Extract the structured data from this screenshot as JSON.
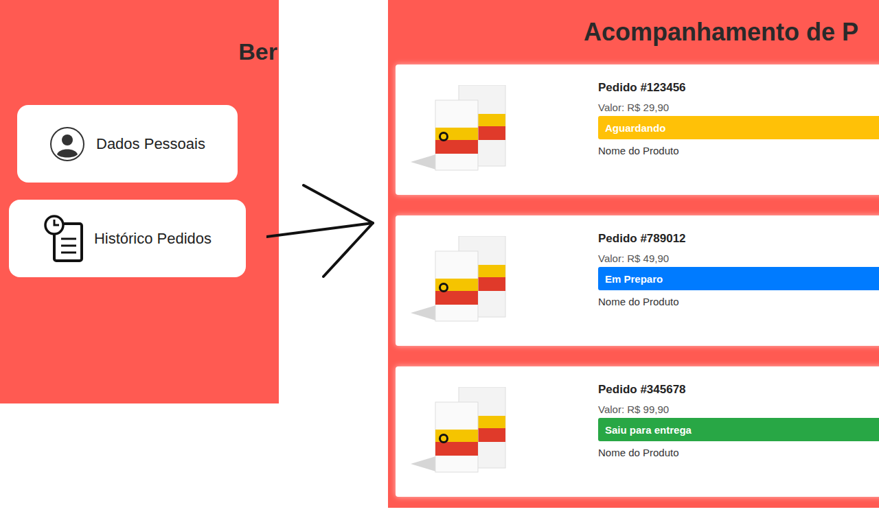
{
  "sidebar": {
    "title": "Ber",
    "items": [
      {
        "label": "Dados Pessoais",
        "kind": "profile",
        "selected": false
      },
      {
        "label": "Histórico Pedidos",
        "kind": "history",
        "selected": true
      }
    ]
  },
  "orders": {
    "title": "Acompanhamento de P",
    "items": [
      {
        "number": "Pedido #123456",
        "value": "Valor: R$ 29,90",
        "status": "Aguardando",
        "color": "#ffc107",
        "product": "Nome do Produto"
      },
      {
        "number": "Pedido #789012",
        "value": "Valor: R$ 49,90",
        "status": "Em Preparo",
        "color": "#007bff",
        "product": "Nome do Produto"
      },
      {
        "number": "Pedido #345678",
        "value": "Valor: R$ 99,90",
        "status": "Saiu para entrega",
        "color": "#28a745",
        "product": "Nome do Produto"
      }
    ]
  }
}
